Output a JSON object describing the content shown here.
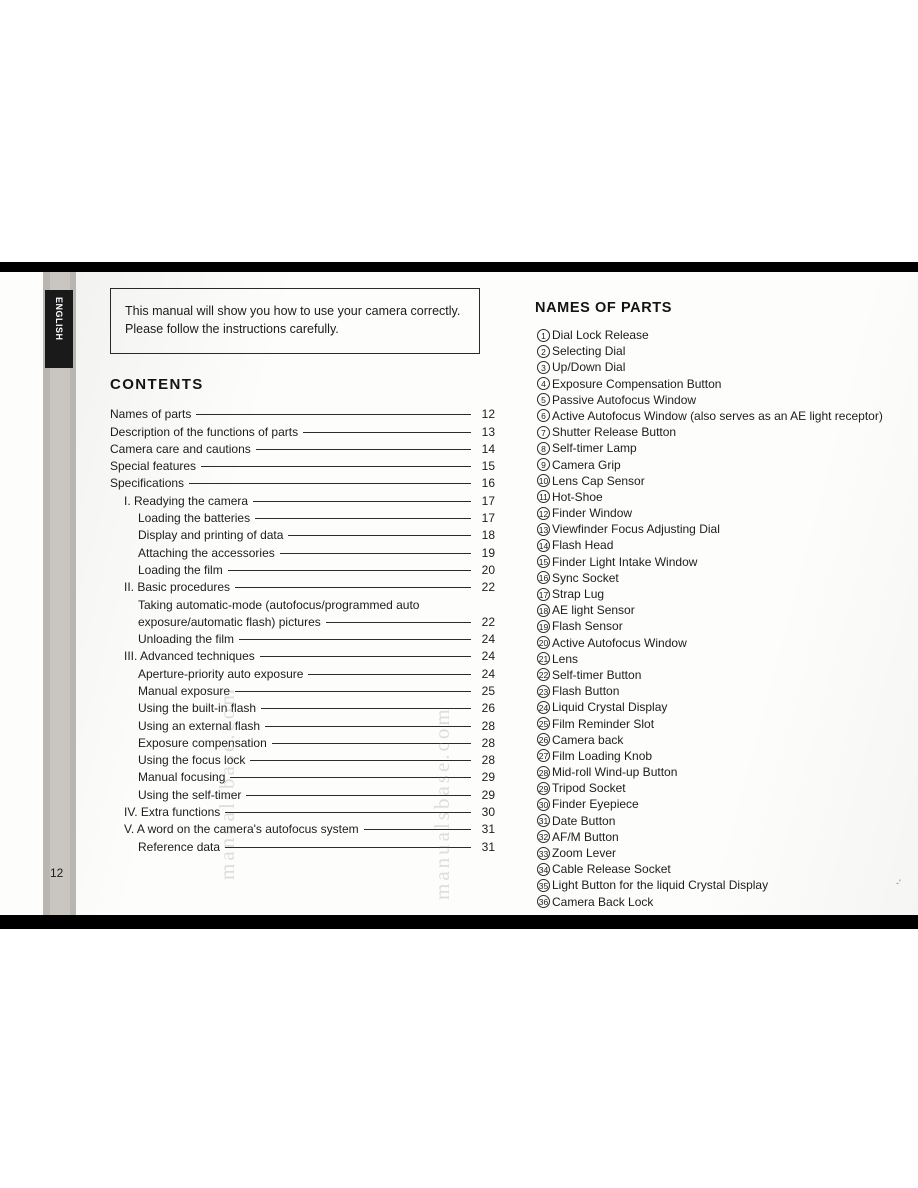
{
  "document": {
    "language_tab": "ENGLISH",
    "page_number": "12",
    "corner_mark": "-'",
    "intro_note": "This manual will show you how to use your camera correctly. Please follow the instructions carefully.",
    "contents_heading": "CONTENTS",
    "names_heading": "NAMES OF PARTS",
    "watermark_1": "manualsbase.com",
    "watermark_2": "manualsbase.com"
  },
  "contents": [
    {
      "label": "Names of parts",
      "page": "12",
      "indent": 0,
      "leader": true
    },
    {
      "label": "Description of the functions of parts",
      "page": "13",
      "indent": 0,
      "leader": true
    },
    {
      "label": "Camera care and cautions",
      "page": "14",
      "indent": 0,
      "leader": true
    },
    {
      "label": "Special features",
      "page": "15",
      "indent": 0,
      "leader": true
    },
    {
      "label": "Specifications",
      "page": "16",
      "indent": 0,
      "leader": true
    },
    {
      "label": "I.  Readying the camera",
      "page": "17",
      "indent": 1,
      "leader": true
    },
    {
      "label": "Loading the batteries",
      "page": "17",
      "indent": 2,
      "leader": true
    },
    {
      "label": "Display and printing of data",
      "page": "18",
      "indent": 2,
      "leader": true
    },
    {
      "label": "Attaching the accessories",
      "page": "19",
      "indent": 2,
      "leader": true
    },
    {
      "label": "Loading the film",
      "page": "20",
      "indent": 2,
      "leader": true
    },
    {
      "label": "II. Basic procedures",
      "page": "22",
      "indent": 1,
      "leader": true
    },
    {
      "label": "Taking automatic-mode (autofocus/programmed auto",
      "page": "",
      "indent": 2,
      "leader": false
    },
    {
      "label": "exposure/automatic flash) pictures",
      "page": "22",
      "indent": 2,
      "leader": true
    },
    {
      "label": "Unloading the film",
      "page": "24",
      "indent": 2,
      "leader": true
    },
    {
      "label": "III. Advanced techniques",
      "page": "24",
      "indent": 1,
      "leader": true
    },
    {
      "label": "Aperture-priority auto exposure",
      "page": "24",
      "indent": 2,
      "leader": true
    },
    {
      "label": "Manual exposure",
      "page": "25",
      "indent": 2,
      "leader": true
    },
    {
      "label": "Using the built-in flash",
      "page": "26",
      "indent": 2,
      "leader": true
    },
    {
      "label": "Using an external flash",
      "page": "28",
      "indent": 2,
      "leader": true
    },
    {
      "label": "Exposure compensation",
      "page": "28",
      "indent": 2,
      "leader": true
    },
    {
      "label": "Using the focus lock",
      "page": "28",
      "indent": 2,
      "leader": true
    },
    {
      "label": "Manual focusing",
      "page": "29",
      "indent": 2,
      "leader": true
    },
    {
      "label": "Using the self-timer",
      "page": "29",
      "indent": 2,
      "leader": true
    },
    {
      "label": "IV. Extra functions",
      "page": "30",
      "indent": 1,
      "leader": true
    },
    {
      "label": "V.  A word on the camera's autofocus system",
      "page": "31",
      "indent": 1,
      "leader": true
    },
    {
      "label": "Reference data",
      "page": "31",
      "indent": 2,
      "leader": true
    }
  ],
  "parts": [
    {
      "num": "1",
      "label": "Dial Lock Release"
    },
    {
      "num": "2",
      "label": "Selecting Dial"
    },
    {
      "num": "3",
      "label": "Up/Down Dial"
    },
    {
      "num": "4",
      "label": "Exposure Compensation Button"
    },
    {
      "num": "5",
      "label": "Passive Autofocus Window"
    },
    {
      "num": "6",
      "label": "Active Autofocus Window (also serves as an AE light receptor)"
    },
    {
      "num": "7",
      "label": "Shutter Release Button"
    },
    {
      "num": "8",
      "label": "Self-timer Lamp"
    },
    {
      "num": "9",
      "label": "Camera Grip"
    },
    {
      "num": "10",
      "label": "Lens Cap Sensor"
    },
    {
      "num": "11",
      "label": "Hot-Shoe"
    },
    {
      "num": "12",
      "label": "Finder Window"
    },
    {
      "num": "13",
      "label": "Viewfinder Focus Adjusting Dial"
    },
    {
      "num": "14",
      "label": "Flash Head"
    },
    {
      "num": "15",
      "label": "Finder Light Intake Window"
    },
    {
      "num": "16",
      "label": "Sync Socket"
    },
    {
      "num": "17",
      "label": "Strap Lug"
    },
    {
      "num": "18",
      "label": "AE light Sensor"
    },
    {
      "num": "19",
      "label": "Flash Sensor"
    },
    {
      "num": "20",
      "label": "Active Autofocus Window"
    },
    {
      "num": "21",
      "label": "Lens"
    },
    {
      "num": "22",
      "label": "Self-timer Button"
    },
    {
      "num": "23",
      "label": "Flash Button"
    },
    {
      "num": "24",
      "label": "Liquid Crystal Display"
    },
    {
      "num": "25",
      "label": "Film Reminder Slot"
    },
    {
      "num": "26",
      "label": "Camera back"
    },
    {
      "num": "27",
      "label": "Film Loading Knob"
    },
    {
      "num": "28",
      "label": "Mid-roll Wind-up Button"
    },
    {
      "num": "29",
      "label": "Tripod Socket"
    },
    {
      "num": "30",
      "label": "Finder Eyepiece"
    },
    {
      "num": "31",
      "label": "Date Button"
    },
    {
      "num": "32",
      "label": "AF/M Button"
    },
    {
      "num": "33",
      "label": "Zoom Lever"
    },
    {
      "num": "34",
      "label": "Cable Release Socket"
    },
    {
      "num": "35",
      "label": "Light Button for the liquid Crystal Display"
    },
    {
      "num": "36",
      "label": "Camera Back Lock"
    }
  ]
}
